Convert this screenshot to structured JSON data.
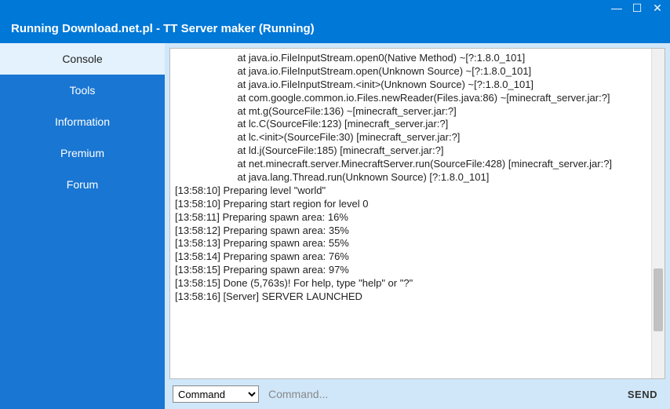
{
  "window": {
    "title": "Running Download.net.pl - TT Server maker (Running)"
  },
  "sidebar": {
    "items": [
      {
        "label": "Console",
        "active": true
      },
      {
        "label": "Tools",
        "active": false
      },
      {
        "label": "Information",
        "active": false
      },
      {
        "label": "Premium",
        "active": false
      },
      {
        "label": "Forum",
        "active": false
      }
    ]
  },
  "console": {
    "lines": [
      "                      at java.io.FileInputStream.open0(Native Method) ~[?:1.8.0_101]",
      "                      at java.io.FileInputStream.open(Unknown Source) ~[?:1.8.0_101]",
      "                      at java.io.FileInputStream.<init>(Unknown Source) ~[?:1.8.0_101]",
      "                      at com.google.common.io.Files.newReader(Files.java:86) ~[minecraft_server.jar:?]",
      "                      at mt.g(SourceFile:136) ~[minecraft_server.jar:?]",
      "                      at lc.C(SourceFile:123) [minecraft_server.jar:?]",
      "                      at lc.<init>(SourceFile:30) [minecraft_server.jar:?]",
      "                      at ld.j(SourceFile:185) [minecraft_server.jar:?]",
      "                      at net.minecraft.server.MinecraftServer.run(SourceFile:428) [minecraft_server.jar:?]",
      "                      at java.lang.Thread.run(Unknown Source) [?:1.8.0_101]",
      "[13:58:10] Preparing level \"world\"",
      "[13:58:10] Preparing start region for level 0",
      "[13:58:11] Preparing spawn area: 16%",
      "[13:58:12] Preparing spawn area: 35%",
      "[13:58:13] Preparing spawn area: 55%",
      "[13:58:14] Preparing spawn area: 76%",
      "[13:58:15] Preparing spawn area: 97%",
      "[13:58:15] Done (5,763s)! For help, type \"help\" or \"?\"",
      "[13:58:16] [Server] SERVER LAUNCHED"
    ]
  },
  "commandbar": {
    "select_label": "Command",
    "input_placeholder": "Command...",
    "send_label": "SEND"
  }
}
